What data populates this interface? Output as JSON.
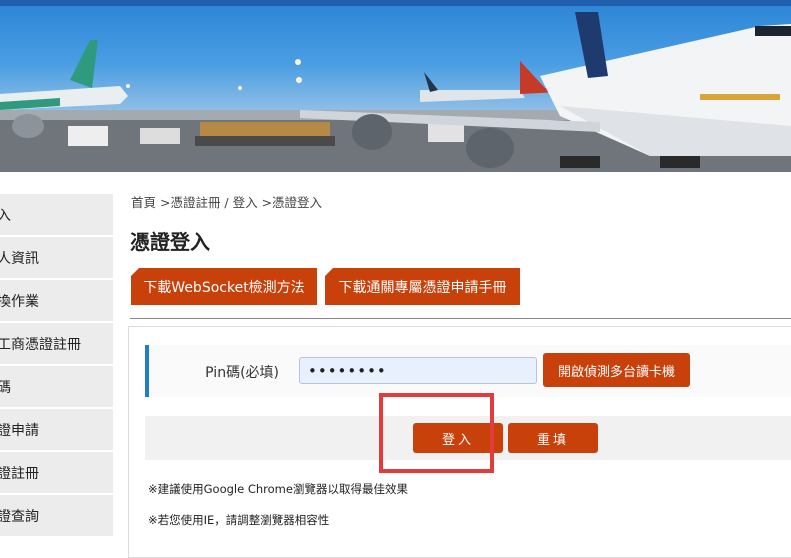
{
  "sidebar": {
    "items": [
      {
        "label": "入"
      },
      {
        "label": "人資訊"
      },
      {
        "label": "換作業"
      },
      {
        "label": "工商憑證註冊"
      },
      {
        "label": "碼"
      },
      {
        "label": "證申請"
      },
      {
        "label": "證註冊"
      },
      {
        "label": "證查詢"
      }
    ]
  },
  "breadcrumb": "首頁 >憑證註冊 / 登入 >憑證登入",
  "page_title": "憑證登入",
  "downloads": {
    "websocket_label": "下載WebSocket檢測方法",
    "manual_label": "下載通關專屬憑證申請手冊"
  },
  "form": {
    "pin_label": "Pin碼(必填)",
    "pin_value": "••••••••",
    "detect_button": "開啟偵測多台讀卡機",
    "login_button": "登入",
    "reset_button": "重填"
  },
  "notes": [
    "※建議使用Google Chrome瀏覽器以取得最佳效果",
    "※若您使用IE，請調整瀏覽器相容性"
  ],
  "colors": {
    "accent": "#c8410b",
    "topbar": "#1f5fae",
    "highlight": "#e23b3b",
    "row_marker": "#1f7fc8"
  }
}
